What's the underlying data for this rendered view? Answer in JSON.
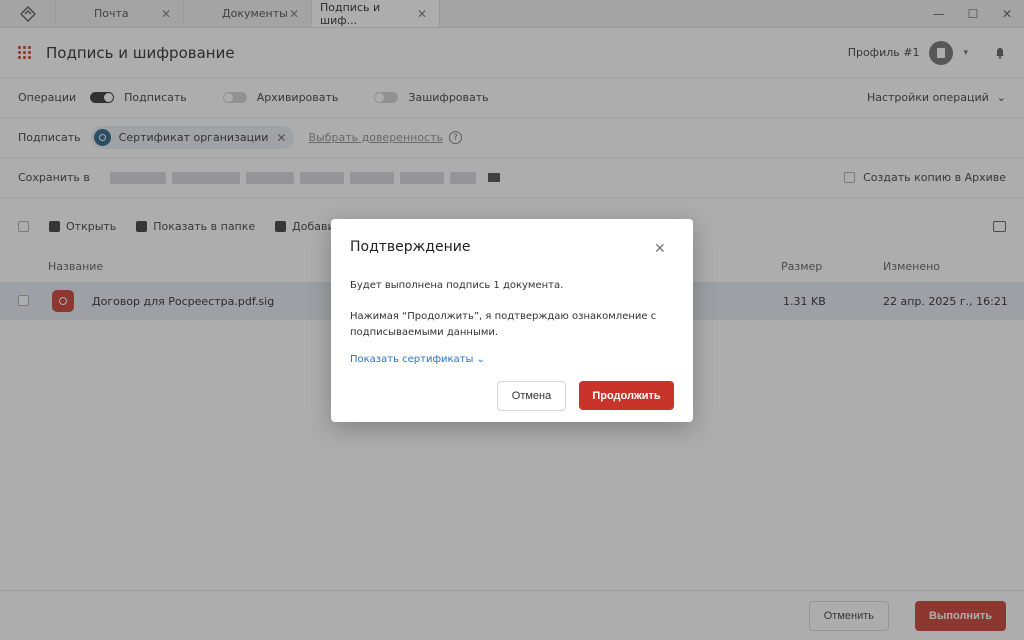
{
  "tabs": [
    {
      "label": "Почта"
    },
    {
      "label": "Документы"
    },
    {
      "label": "Подпись и шиф..."
    }
  ],
  "tab_close": "✕",
  "window_controls": {
    "minimize": "—",
    "maximize": "☐",
    "close": "✕"
  },
  "header": {
    "title": "Подпись и шифрование",
    "profile": "Профиль #1",
    "caret": "▾"
  },
  "operations": {
    "label": "Операции",
    "sign": "Подписать",
    "sign_on": true,
    "archive": "Архивировать",
    "archive_on": false,
    "encrypt": "Зашифровать",
    "encrypt_on": false,
    "settings": "Настройки операций",
    "settings_caret": "⌄"
  },
  "sign_row": {
    "label": "Подписать",
    "certificate": "Сертификат организации",
    "remove": "✕",
    "choose_proxy": "Выбрать доверенность",
    "help": "?"
  },
  "save_row": {
    "label": "Сохранить в",
    "archive_copy": "Создать копию в Архиве"
  },
  "toolbar": {
    "open": "Открыть",
    "show_in_folder": "Показать в папке",
    "add": "Добавить"
  },
  "table": {
    "headers": {
      "name": "Название",
      "size": "Размер",
      "modified": "Изменено"
    },
    "rows": [
      {
        "name": "Договор для Росреестра.pdf.sig",
        "size": "1.31 KB",
        "modified": "22 апр. 2025 г., 16:21"
      }
    ]
  },
  "footer": {
    "cancel": "Отменить",
    "execute": "Выполнить"
  },
  "modal": {
    "title": "Подтверждение",
    "close": "✕",
    "text1": "Будет выполнена подпись 1 документа.",
    "text2": "Нажимая “Продолжить”, я подтверждаю ознакомление с подписываемыми данными.",
    "show_certs": "Показать сертификаты ⌄",
    "cancel": "Отмена",
    "continue": "Продолжить"
  },
  "colors": {
    "accent": "#c9342a",
    "link": "#2a74c9",
    "chip_bg": "#e9eef3",
    "selected_row": "#e4e9f0"
  }
}
